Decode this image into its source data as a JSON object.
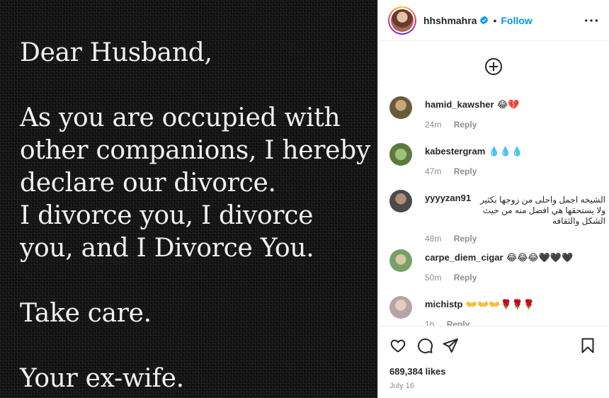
{
  "post": {
    "letter": {
      "greeting": "Dear Husband,",
      "paragraph1": "As you are occupied with\nother companions, I hereby\ndeclare our divorce.\nI divorce you, I divorce\nyou, and I Divorce You.",
      "paragraph2": "Take care.",
      "signoff": "Your ex-wife."
    }
  },
  "header": {
    "username": "hhshmahra",
    "verified_icon": "verified-badge-icon",
    "separator": "•",
    "follow_label": "Follow",
    "more_icon": "more-options-icon"
  },
  "add_icon": "add-circle-icon",
  "comments": [
    {
      "user": "hamid_kawsher",
      "text": "😂💔",
      "time": "24m",
      "reply": "Reply",
      "avatar_color": "#6b5a3a"
    },
    {
      "user": "kabestergram",
      "text": "💧💧💧",
      "time": "47m",
      "reply": "Reply",
      "avatar_color": "#5d7a3e"
    },
    {
      "user": "yyyyzan91",
      "text": "الشيخه اجمل واحلى من زوجها بكثير ولا يستحقها هي افضل منه من حيث الشكل والثقافه",
      "time": "48m",
      "reply": "Reply",
      "avatar_color": "#4a4a4a"
    },
    {
      "user": "carpe_diem_cigar",
      "text": "😂😂😂🖤🖤🖤",
      "time": "50m",
      "reply": "Reply",
      "avatar_color": "#7aa06a"
    },
    {
      "user": "michistp",
      "text": "👐👐👐🌹🌹🌹",
      "time": "1h",
      "reply": "Reply",
      "avatar_color": "#b7a4a8"
    }
  ],
  "actions": {
    "like_icon": "heart-icon",
    "comment_icon": "comment-icon",
    "share_icon": "share-icon",
    "save_icon": "bookmark-icon"
  },
  "likes": "689,384 likes",
  "date": "July 16",
  "colors": {
    "accent": "#0095f6",
    "muted": "#8e8e8e",
    "text": "#262626"
  }
}
